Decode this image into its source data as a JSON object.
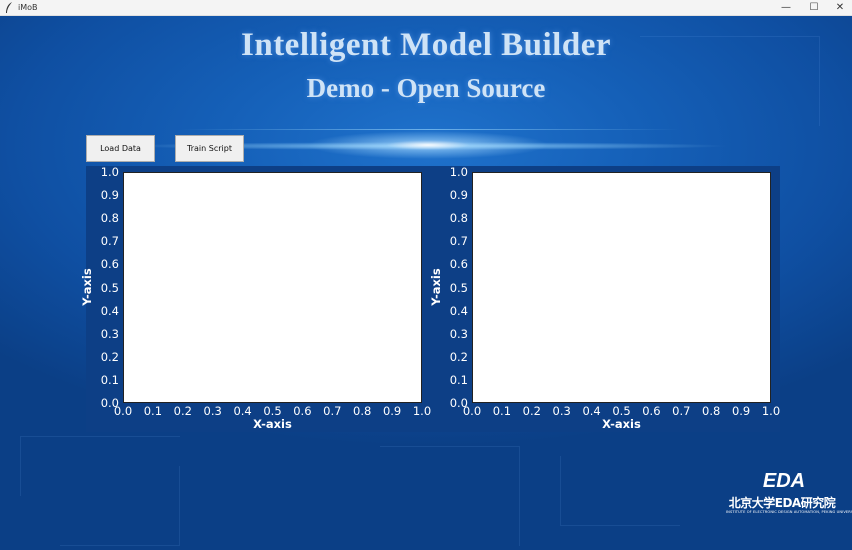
{
  "window": {
    "title": "iMoB",
    "controls": {
      "minimize": "—",
      "maximize": "☐",
      "close": "✕"
    }
  },
  "header": {
    "title": "Intelligent Model Builder",
    "subtitle": "Demo - Open Source"
  },
  "toolbar": {
    "load_label": "Load Data",
    "train_label": "Train Script"
  },
  "plots": [
    {
      "chart_data": {
        "type": "scatter",
        "series": [],
        "xlabel": "X-axis",
        "ylabel": "Y-axis",
        "xlim": [
          0.0,
          1.0
        ],
        "ylim": [
          0.0,
          1.0
        ],
        "xticks": [
          "0.0",
          "0.1",
          "0.2",
          "0.3",
          "0.4",
          "0.5",
          "0.6",
          "0.7",
          "0.8",
          "0.9",
          "1.0"
        ],
        "yticks": [
          "0.0",
          "0.1",
          "0.2",
          "0.3",
          "0.4",
          "0.5",
          "0.6",
          "0.7",
          "0.8",
          "0.9",
          "1.0"
        ]
      }
    },
    {
      "chart_data": {
        "type": "scatter",
        "series": [],
        "xlabel": "X-axis",
        "ylabel": "Y-axis",
        "xlim": [
          0.0,
          1.0
        ],
        "ylim": [
          0.0,
          1.0
        ],
        "xticks": [
          "0.0",
          "0.1",
          "0.2",
          "0.3",
          "0.4",
          "0.5",
          "0.6",
          "0.7",
          "0.8",
          "0.9",
          "1.0"
        ],
        "yticks": [
          "0.0",
          "0.1",
          "0.2",
          "0.3",
          "0.4",
          "0.5",
          "0.6",
          "0.7",
          "0.8",
          "0.9",
          "1.0"
        ]
      }
    }
  ],
  "logo": {
    "mark": "EDA",
    "org_cn": "北京大学EDA研究院",
    "org_en": "INSTITUTE OF ELECTRONIC DESIGN AUTOMATION, PEKING UNIVERSITY"
  },
  "colors": {
    "background": "#1560b8",
    "plot_panel": "#0d3f86",
    "title_text": "#cfe3f6"
  }
}
